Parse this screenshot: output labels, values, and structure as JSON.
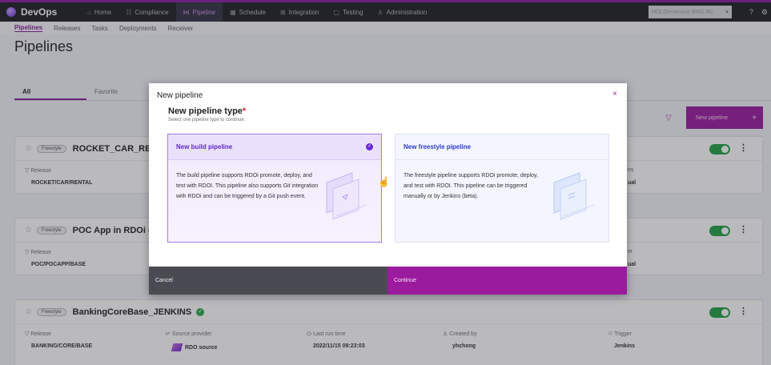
{
  "app": {
    "brand": "DevOps",
    "nav": [
      {
        "label": "Home",
        "icon": "home-icon",
        "glyph": "⌂"
      },
      {
        "label": "Compliance",
        "icon": "compliance-icon",
        "glyph": "☷"
      },
      {
        "label": "Pipeline",
        "icon": "pipeline-icon",
        "glyph": "⋈"
      },
      {
        "label": "Schedule",
        "icon": "schedule-icon",
        "glyph": "▦"
      },
      {
        "label": "Integration",
        "icon": "integration-icon",
        "glyph": "⊞"
      },
      {
        "label": "Testing",
        "icon": "testing-icon",
        "glyph": "▢"
      },
      {
        "label": "Administration",
        "icon": "admin-icon",
        "glyph": "♙"
      }
    ],
    "active_nav": "Pipeline",
    "workspace": "HOLDerservice RNG RC",
    "help_icon": "help-icon",
    "settings_icon": "settings-icon"
  },
  "subnav": [
    "Pipelines",
    "Releases",
    "Tasks",
    "Deployments",
    "Receiver"
  ],
  "page_title": "Pipelines",
  "tabs": [
    "All",
    "Favorite"
  ],
  "toolbar": {
    "new_pipeline": "New pipeline",
    "plus": "+"
  },
  "cards": [
    {
      "tag": "Freestyle",
      "name": "ROCKET_CAR_RE",
      "release_label": "Release",
      "release": "ROCKET/CAR/RENTAL",
      "trigger_label": "es",
      "trigger": "ual"
    },
    {
      "tag": "Freestyle",
      "name": "POC App in RDOi -",
      "release_label": "Release",
      "release": "POC/POCAPP/BASE",
      "trigger_label": "er",
      "trigger": "ual"
    },
    {
      "tag": "Freestyle",
      "name": "BankingCoreBase_JENKINS",
      "release_label": "Release",
      "release": "BANKING/CORE/BASE",
      "source_label": "Source provider",
      "source": "RDO source",
      "run_label": "Last run time",
      "run": "2022/11/15 09:23:03",
      "created_label": "Created by",
      "created": "yhchong",
      "trigger_label": "Trigger",
      "trigger": "Jenkins"
    }
  ],
  "modal": {
    "header": "New pipeline",
    "close": "×",
    "title": "New pipeline type",
    "required": "*",
    "subtitle": "Select one pipeline type to continue:",
    "options": [
      {
        "title": "New build pipeline",
        "selected": true,
        "desc": "The build pipeline supports RDOi promote, deploy, and test with RDOI. This pipeline also supports Git integration with RDOi and can be triggered by a Git push event."
      },
      {
        "title": "New freestyle pipeline",
        "selected": false,
        "desc": "The freestyle pipeline supports RDOi promote, deploy, and test with RDOI. This pipeline can be triggered manually or by Jenkins (beta)."
      }
    ],
    "cancel": "Cancel",
    "continue": "Continue"
  },
  "colors": {
    "accent": "#9b1b9e",
    "topbar": "#1f1f26",
    "toggle_on": "#24a148",
    "link_blue": "#2c3cc8"
  }
}
